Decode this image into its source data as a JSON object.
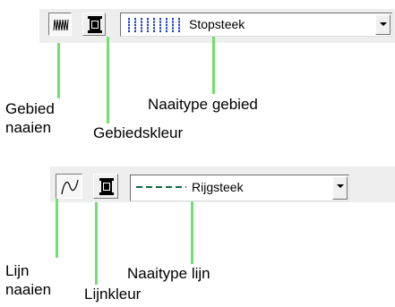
{
  "area_toolbar": {
    "sew_area_icon": "zigzag-fill-icon",
    "area_color_icon": "thread-spool-icon",
    "sew_type_value": "Stopsteek",
    "sew_type_swatch_color": "#1f3fd0"
  },
  "line_toolbar": {
    "sew_line_icon": "curve-line-icon",
    "line_color_icon": "thread-spool-icon",
    "sew_type_value": "Rijgsteek",
    "sew_type_swatch_color": "#0d6b3f"
  },
  "labels": {
    "sew_area": [
      "Gebied",
      "naaien"
    ],
    "area_color": "Gebiedskleur",
    "area_sew_type": "Naaitype gebied",
    "sew_line": [
      "Lijn",
      "naaien"
    ],
    "line_color": "Lijnkleur",
    "line_sew_type": "Naaitype lijn"
  },
  "pointer_color": "#6fe16f"
}
